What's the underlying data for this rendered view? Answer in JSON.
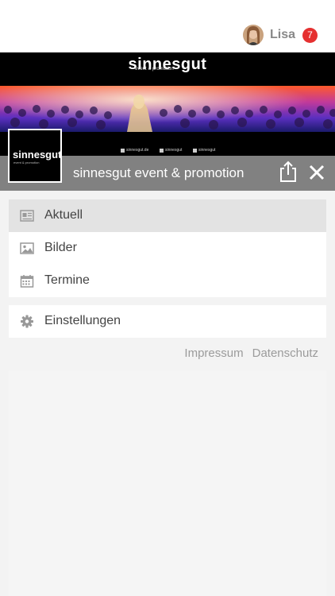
{
  "user": {
    "name": "Lisa",
    "notification_count": "7"
  },
  "banner": {
    "brand": "sinnesgut",
    "tagline": "event & promotion",
    "social": [
      "sinnesgut.de",
      "sinnesgut",
      "sinnesgut"
    ]
  },
  "logo": {
    "brand": "sinnesgut",
    "tagline": "event & promotion"
  },
  "titlebar": {
    "title": "sinnesgut event & promotion"
  },
  "menu": {
    "main": [
      {
        "label": "Aktuell",
        "icon": "newspaper-icon",
        "active": true
      },
      {
        "label": "Bilder",
        "icon": "image-icon",
        "active": false
      },
      {
        "label": "Termine",
        "icon": "calendar-icon",
        "active": false
      }
    ],
    "settings": {
      "label": "Einstellungen",
      "icon": "gear-icon"
    }
  },
  "footer": {
    "impressum": "Impressum",
    "datenschutz": "Datenschutz"
  },
  "colors": {
    "titlebar": "#818181",
    "badge": "#e53030",
    "active_item": "#e3e3e3"
  }
}
